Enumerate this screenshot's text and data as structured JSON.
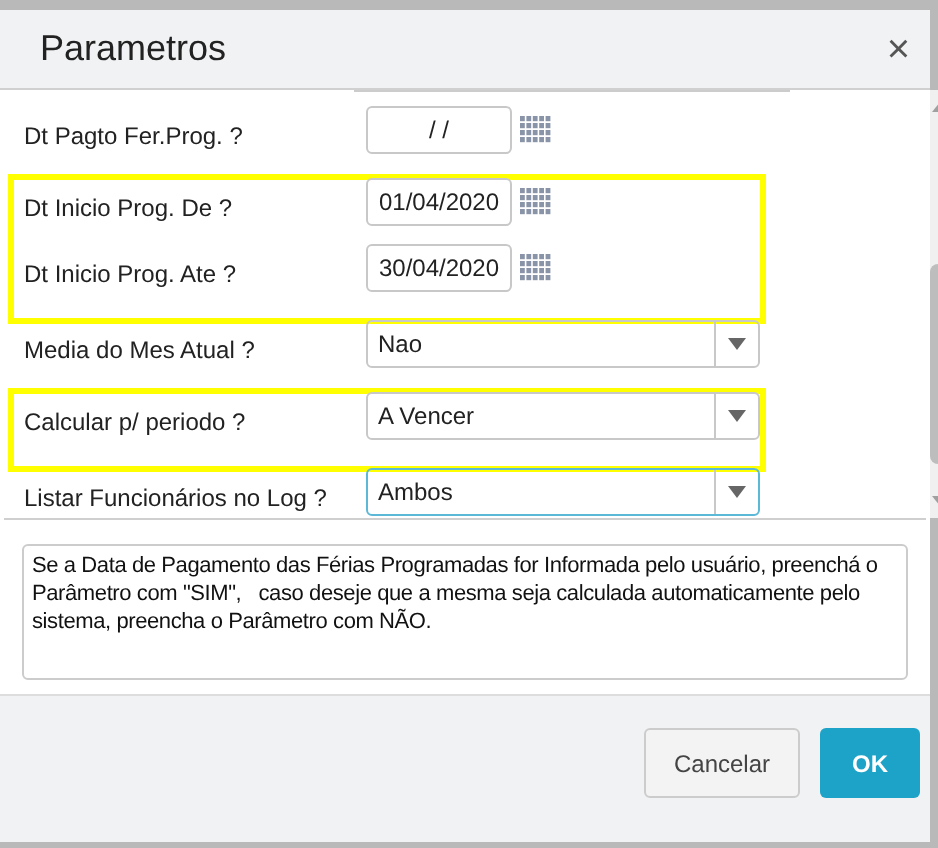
{
  "dialog": {
    "title": "Parametros",
    "close": "×"
  },
  "parameters": [
    {
      "label": "Dt Pagto Fer.Prog. ?",
      "kind": "date",
      "value": "/ /",
      "highlighted": false,
      "focused": false
    },
    {
      "label": "Dt Inicio Prog. De ?",
      "kind": "date",
      "value": "01/04/2020",
      "highlighted": true,
      "focused": false
    },
    {
      "label": "Dt Inicio Prog. Ate ?",
      "kind": "date",
      "value": "30/04/2020",
      "highlighted": true,
      "focused": false
    },
    {
      "label": "Media do Mes Atual ?",
      "kind": "select",
      "value": "Nao",
      "highlighted": false,
      "focused": false
    },
    {
      "label": "Calcular p/ periodo ?",
      "kind": "select",
      "value": "A Vencer",
      "highlighted": true,
      "focused": false
    },
    {
      "label": "Listar Funcionários no Log ?",
      "kind": "select",
      "value": "Ambos",
      "highlighted": false,
      "focused": true
    }
  ],
  "help_text": "Se a Data de Pagamento das Férias Programadas for Informada pelo usuário, preenchá o Parâmetro com \"SIM\",   caso deseje que a mesma seja calculada automaticamente pelo sistema, preencha o Parâmetro com NÃO.",
  "buttons": [
    {
      "label": "Cancelar",
      "kind": "secondary"
    },
    {
      "label": "OK",
      "kind": "primary"
    }
  ]
}
